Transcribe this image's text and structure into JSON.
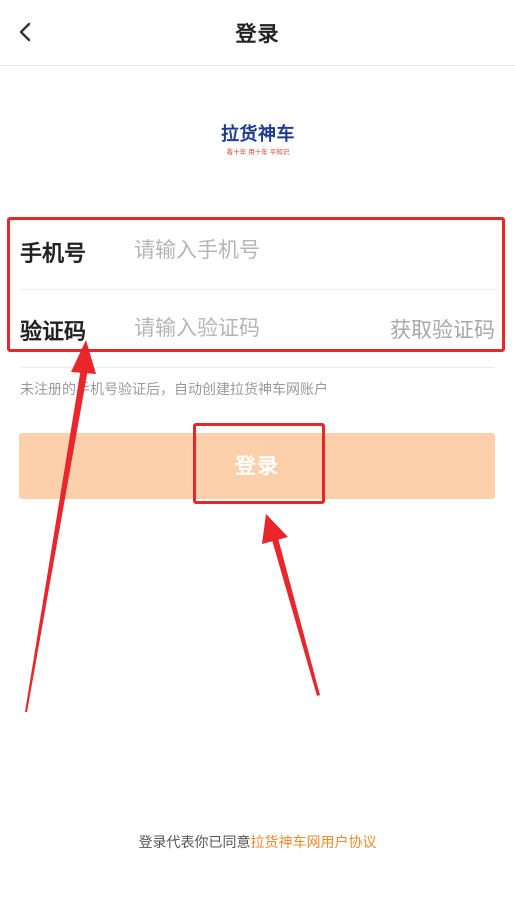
{
  "header": {
    "back_icon": "chevron-left-icon",
    "title": "登录"
  },
  "logo": {
    "title": "拉货神车",
    "slogan": "看十年 用十年 平知识"
  },
  "form": {
    "phone": {
      "label": "手机号",
      "placeholder": "请输入手机号"
    },
    "code": {
      "label": "验证码",
      "placeholder": "请输入验证码",
      "get_code_label": "获取验证码"
    },
    "hint": "未注册的手机号验证后，自动创建拉货神车网账户"
  },
  "login_button": {
    "label": "登录",
    "color": "#fbd0ab"
  },
  "footer": {
    "prefix": "登录代表你已同意",
    "link": "拉货神车网用户协议"
  },
  "annotation": {
    "color": "#e8262b"
  }
}
